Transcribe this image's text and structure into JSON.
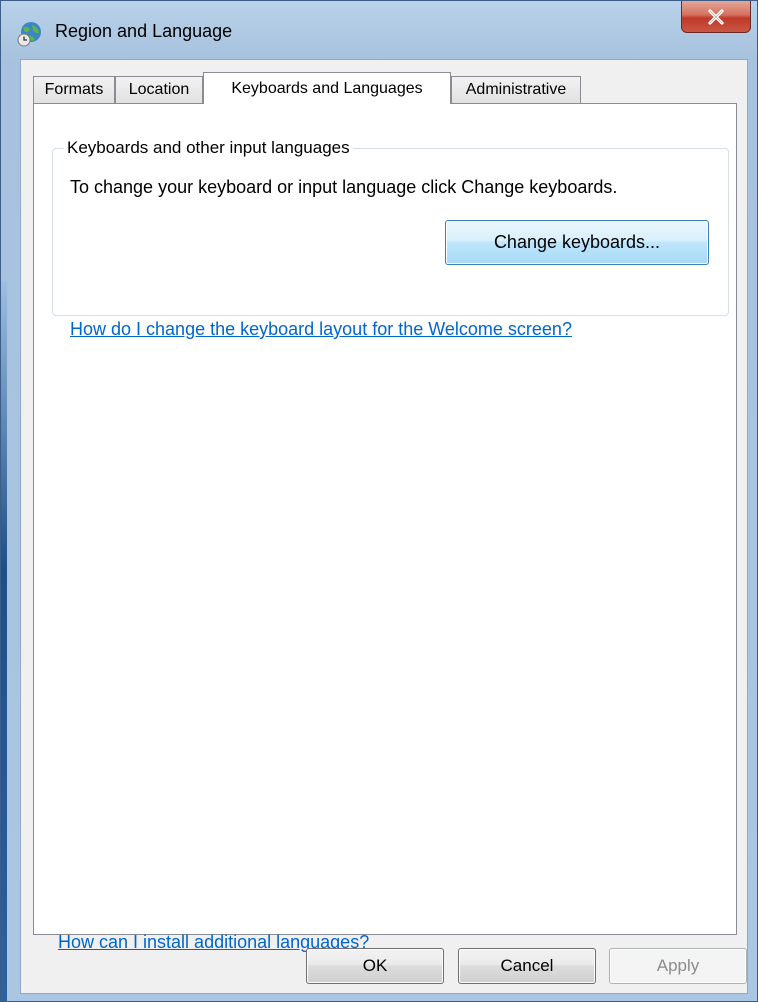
{
  "window": {
    "title": "Region and Language",
    "icon": "globe-clock-icon",
    "close_icon": "close-icon"
  },
  "tabs": [
    {
      "label": "Formats",
      "active": false
    },
    {
      "label": "Location",
      "active": false
    },
    {
      "label": "Keyboards and Languages",
      "active": true
    },
    {
      "label": "Administrative",
      "active": false
    }
  ],
  "keyboards_group": {
    "label": "Keyboards and other input languages",
    "description": "To change your keyboard or input language click Change keyboards.",
    "change_button": "Change keyboards...",
    "welcome_link": "How do I change the keyboard layout for the Welcome screen?"
  },
  "install_link": "How can I install additional languages?",
  "buttons": {
    "ok": "OK",
    "cancel": "Cancel",
    "apply": "Apply"
  },
  "colors": {
    "link": "#0066cc",
    "close_button": "#c0392b"
  }
}
